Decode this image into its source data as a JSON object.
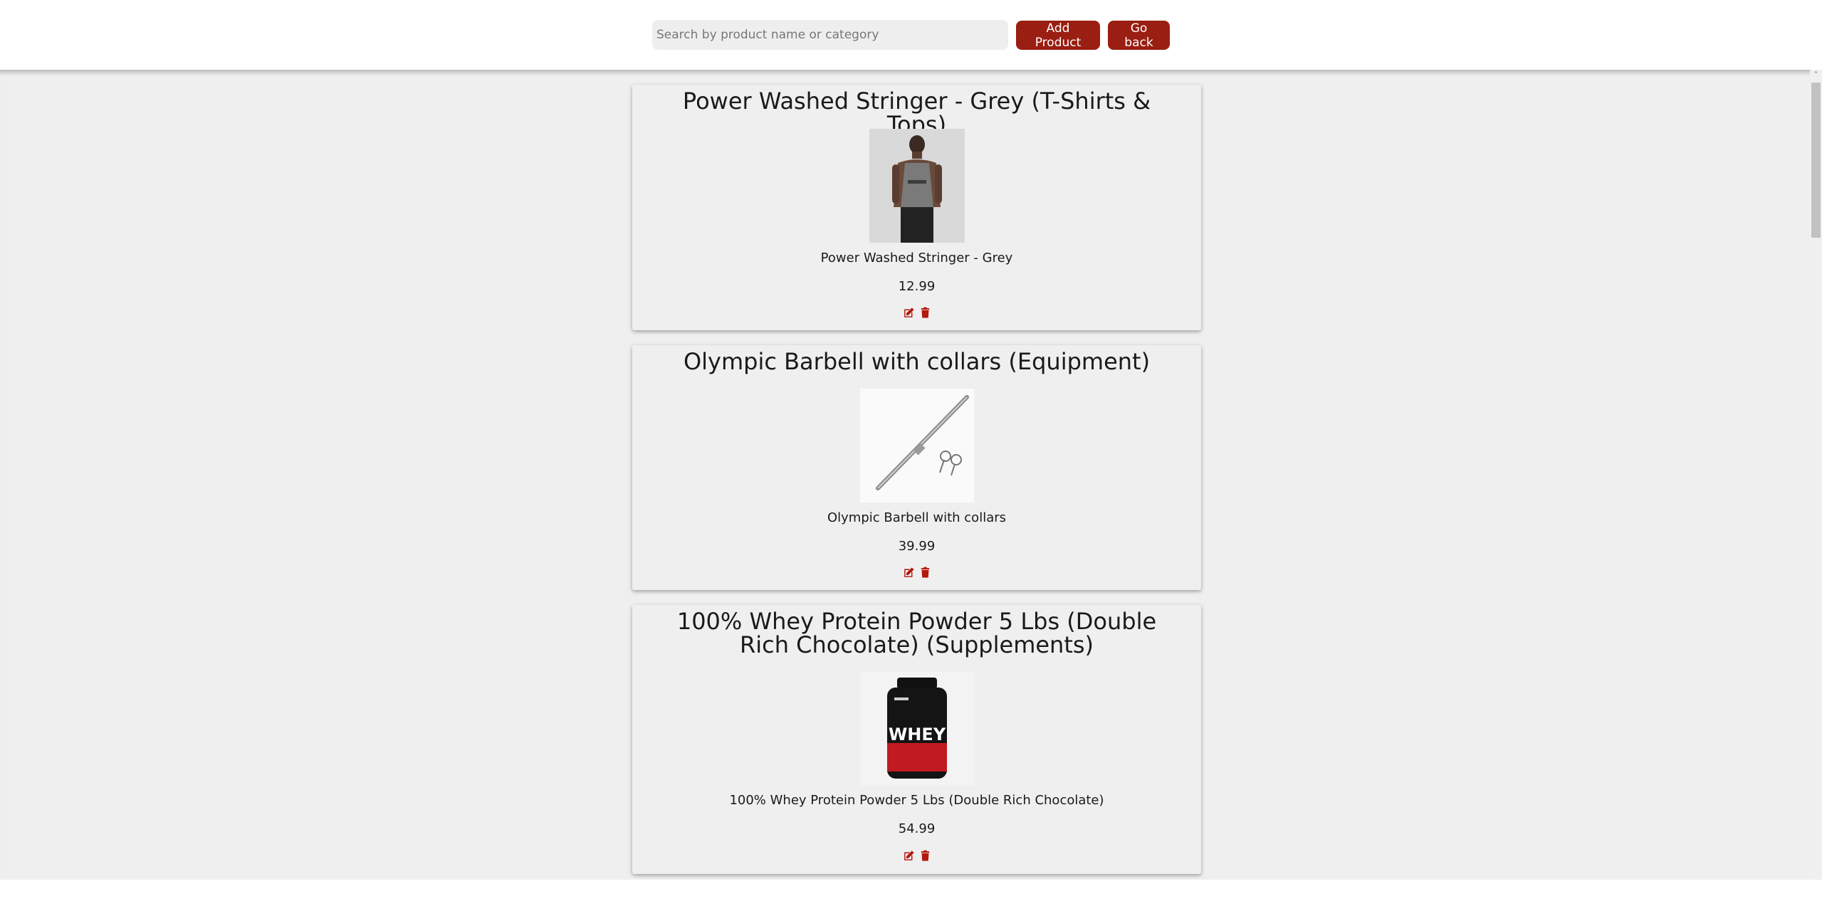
{
  "header": {
    "search_placeholder": "Search by product name or category",
    "add_label": "Add Product",
    "back_label": "Go back"
  },
  "products": [
    {
      "title": "Power Washed Stringer - Grey (T-Shirts & Tops)",
      "name": "Power Washed Stringer - Grey",
      "price": "12.99",
      "image": "grey-stringer-photo"
    },
    {
      "title": "Olympic Barbell with collars (Equipment)",
      "name": "Olympic Barbell with collars",
      "price": "39.99",
      "image": "barbell-photo"
    },
    {
      "title": "100% Whey Protein Powder 5 Lbs (Double Rich Chocolate) (Supplements)",
      "name": "100% Whey Protein Powder 5 Lbs (Double Rich Chocolate)",
      "price": "54.99",
      "image": "whey-tub-photo"
    }
  ],
  "whey_label": "WHEY",
  "colors": {
    "accent": "#9a1e12",
    "background": "#efefef"
  },
  "icons": [
    "edit-icon",
    "trash-icon",
    "scroll-up-icon"
  ]
}
